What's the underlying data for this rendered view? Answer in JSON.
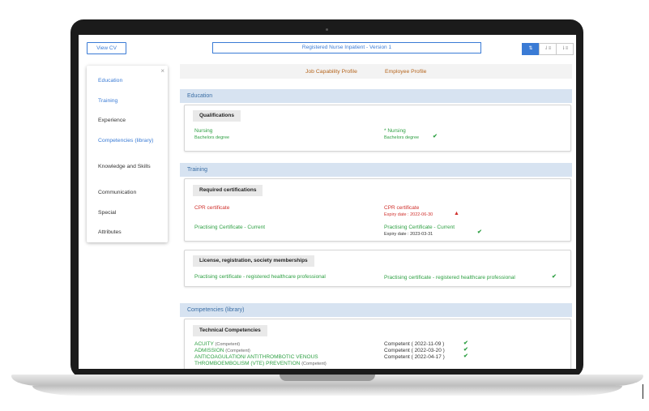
{
  "toolbar": {
    "view_cv_label": "View CV",
    "profile_title": "Registered Nurse Inpatient - Version 1",
    "view_buttons": [
      "⇅",
      "⇃≡",
      "⇂≡"
    ]
  },
  "sidebar": {
    "close_glyph": "×",
    "items": [
      {
        "label": "Education"
      },
      {
        "label": "Training"
      },
      {
        "label": "Experience"
      },
      {
        "label": "Competencies (library)"
      },
      {
        "label": "Knowledge and Skills"
      },
      {
        "label": "Communication"
      },
      {
        "label": "Special"
      },
      {
        "label": "Attributes"
      }
    ]
  },
  "columns": {
    "job": "Job Capability Profile",
    "employee": "Employee Profile"
  },
  "education": {
    "title": "Education",
    "group": "Qualifications",
    "job_name": "Nursing",
    "job_detail": "Bachelors degree",
    "emp_name": "* Nursing",
    "emp_detail": "Bachelors degree"
  },
  "training": {
    "title": "Training",
    "group1": "Required certifications",
    "cpr_job": "CPR certificate",
    "cpr_emp": "CPR certificate",
    "cpr_expiry": "Expiry date : 2022-06-30",
    "prac_job": "Practising Certificate - Current",
    "prac_emp": "Practising Certificate - Current",
    "prac_expiry": "Expiry date : 2023-03-31",
    "group2": "License, registration, society memberships",
    "lic_job": "Practising certificate - registered healthcare professional",
    "lic_emp": "Practising certificate - registered healthcare professional"
  },
  "competencies": {
    "title": "Competencies (library)",
    "group": "Technical Competencies",
    "items": [
      {
        "name": "ACUITY",
        "level": "(Competent)",
        "emp": "Competent ( 2022-11-09 )"
      },
      {
        "name": "ADMISSION",
        "level": "(Competent)",
        "emp": "Competent ( 2022-03-20 )"
      },
      {
        "name": "ANTICOAGULATION/ ANTITHROMBOTIC VENOUS",
        "level": "",
        "emp": "Competent ( 2022-04-17 )"
      },
      {
        "name": "THROMBOEMBOLISM (VTE) PREVENTION",
        "level": "(Competent)",
        "emp": ""
      }
    ]
  },
  "icons": {
    "check": "✔",
    "warning": "▲"
  },
  "colors": {
    "accent": "#3a7bd5",
    "green": "#2ea043",
    "red": "#d0312d",
    "section": "#d7e3f1",
    "heading": "#b5651d"
  }
}
